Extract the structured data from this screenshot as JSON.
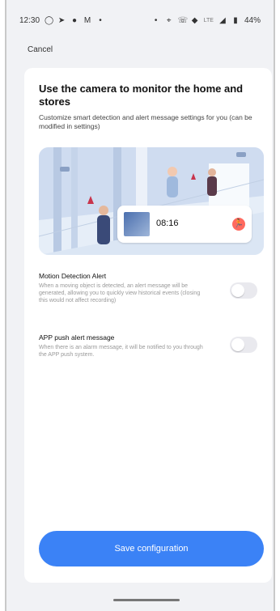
{
  "status": {
    "time": "12:30",
    "left_icons": [
      "whatsapp-icon",
      "telegram-icon",
      "chat-bubble-icon",
      "m-app-icon",
      "dot-icon"
    ],
    "right_icons": [
      "dot-icon",
      "location-icon",
      "wifi-call-icon",
      "wifi-icon",
      "signal-icon",
      "battery-icon"
    ],
    "lte": "LTE",
    "battery": "44%"
  },
  "header": {
    "cancel": "Cancel"
  },
  "sheet": {
    "title": "Use the camera to monitor the home and stores",
    "subtitle": "Customize smart detection and alert message settings for you (can be modified in settings)",
    "illustration": {
      "time": "08:16",
      "badge_icon": "running-person-icon"
    },
    "settings": [
      {
        "title": "Motion Detection Alert",
        "desc": "When a moving object is detected, an alert message will be generated, allowing you to quickly view historical events (closing this would not affect recording)",
        "enabled": false
      },
      {
        "title": "APP push alert message",
        "desc": "When there is an alarm message, it will be notified to you through the APP push system.",
        "enabled": false
      }
    ],
    "save_label": "Save configuration"
  },
  "colors": {
    "accent": "#3b82f6",
    "badge": "#ff6a5f"
  }
}
